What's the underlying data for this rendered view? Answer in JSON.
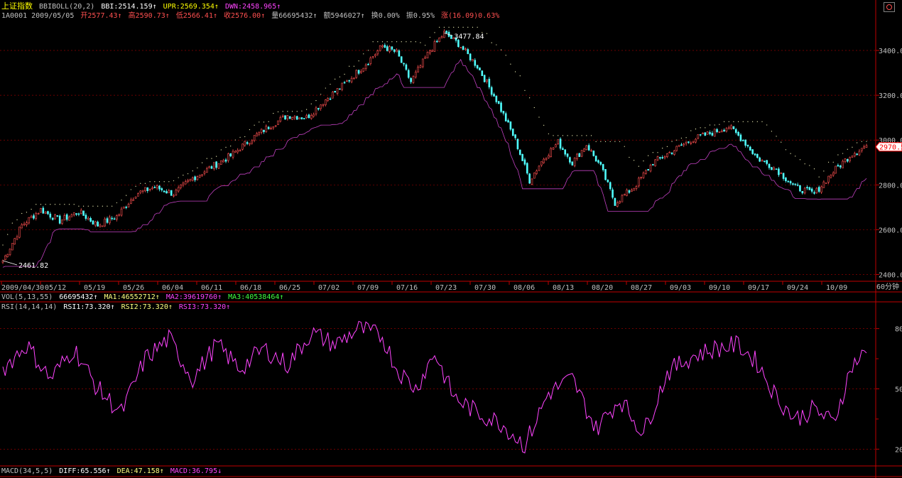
{
  "header": {
    "index_name": "上证指数",
    "indicator": "BBIBOLL(20,2)",
    "bbi": "BBI:2514.159",
    "upr": "UPR:2569.354",
    "dwn": "DWN:2458.965"
  },
  "info": {
    "code_date": "1A0001 2009/05/05",
    "open": "开2577.43",
    "high": "高2590.73",
    "low": "低2566.41",
    "close": "收2576.00",
    "vol": "量66695432",
    "amount": "额5946027",
    "turnover": "换0.00%",
    "amplitude": "振0.95%",
    "change": "涨(16.09)0.63%"
  },
  "price_panel": {
    "y_ticks": [
      2400,
      2600,
      2800,
      3000,
      3200,
      3400
    ],
    "y_tick_labels": [
      "2400.00",
      "2600.00",
      "2800.00",
      "3000.00",
      "3200.00",
      "3400.00"
    ],
    "last_price_label": "2970.5",
    "high_annotation": "3477.84",
    "low_annotation": "2461.82"
  },
  "dates": {
    "labels": [
      "2009/04/30",
      "05/12",
      "05/19",
      "05/26",
      "06/04",
      "06/11",
      "06/18",
      "06/25",
      "07/02",
      "07/09",
      "07/16",
      "07/23",
      "07/30",
      "08/06",
      "08/13",
      "08/20",
      "08/27",
      "09/03",
      "09/10",
      "09/17",
      "09/24",
      "10/09"
    ],
    "period": "60分钟"
  },
  "vol_row": {
    "name": "VOL(5,13,55)",
    "value": "66695432",
    "ma1": "MA1:46552712",
    "ma2": "MA2:39619760",
    "ma3": "MA3:40538464"
  },
  "rsi_row": {
    "name": "RSI(14,14,14)",
    "rsi1": "RSI1:73.320",
    "rsi2": "RSI2:73.320",
    "rsi3": "RSI3:73.320",
    "y_ticks": [
      "80",
      "50",
      "20"
    ]
  },
  "macd_row": {
    "name": "MACD(34,5,5)",
    "diff": "DIFF:65.556",
    "dea": "DEA:47.158",
    "macd": "MACD:36.795"
  },
  "colors": {
    "up": "#ff5050",
    "down": "#50ffff",
    "rsi": "#ff44ff",
    "upper_band": "#ffffc0",
    "lower_band": "#c040c0",
    "axis": "#c00000",
    "grid": "#900000",
    "header_yellow": "#ffff00"
  },
  "chart_data": {
    "type": "line",
    "price_anchors": [
      [
        0,
        2462
      ],
      [
        8,
        2620
      ],
      [
        16,
        2690
      ],
      [
        24,
        2640
      ],
      [
        32,
        2680
      ],
      [
        40,
        2620
      ],
      [
        48,
        2660
      ],
      [
        56,
        2760
      ],
      [
        64,
        2790
      ],
      [
        72,
        2760
      ],
      [
        80,
        2830
      ],
      [
        88,
        2880
      ],
      [
        96,
        2930
      ],
      [
        104,
        3000
      ],
      [
        112,
        3060
      ],
      [
        120,
        3110
      ],
      [
        128,
        3100
      ],
      [
        136,
        3180
      ],
      [
        144,
        3250
      ],
      [
        152,
        3330
      ],
      [
        160,
        3420
      ],
      [
        166,
        3390
      ],
      [
        172,
        3260
      ],
      [
        180,
        3400
      ],
      [
        186,
        3478
      ],
      [
        192,
        3430
      ],
      [
        200,
        3330
      ],
      [
        208,
        3180
      ],
      [
        216,
        3000
      ],
      [
        222,
        2820
      ],
      [
        228,
        2920
      ],
      [
        234,
        2990
      ],
      [
        240,
        2900
      ],
      [
        246,
        2980
      ],
      [
        252,
        2880
      ],
      [
        258,
        2720
      ],
      [
        266,
        2790
      ],
      [
        274,
        2900
      ],
      [
        282,
        2950
      ],
      [
        290,
        3000
      ],
      [
        298,
        3030
      ],
      [
        306,
        3060
      ],
      [
        312,
        3000
      ],
      [
        318,
        2920
      ],
      [
        326,
        2870
      ],
      [
        334,
        2790
      ],
      [
        342,
        2760
      ],
      [
        350,
        2860
      ],
      [
        358,
        2940
      ],
      [
        364,
        2975
      ]
    ],
    "rsi_anchors": [
      [
        0,
        60
      ],
      [
        10,
        72
      ],
      [
        20,
        55
      ],
      [
        30,
        70
      ],
      [
        40,
        50
      ],
      [
        50,
        38
      ],
      [
        60,
        65
      ],
      [
        70,
        75
      ],
      [
        80,
        55
      ],
      [
        90,
        72
      ],
      [
        100,
        60
      ],
      [
        110,
        70
      ],
      [
        120,
        62
      ],
      [
        130,
        78
      ],
      [
        140,
        72
      ],
      [
        150,
        80
      ],
      [
        160,
        76
      ],
      [
        166,
        60
      ],
      [
        174,
        50
      ],
      [
        182,
        68
      ],
      [
        190,
        46
      ],
      [
        200,
        38
      ],
      [
        210,
        33
      ],
      [
        220,
        22
      ],
      [
        230,
        48
      ],
      [
        240,
        55
      ],
      [
        250,
        30
      ],
      [
        260,
        45
      ],
      [
        270,
        28
      ],
      [
        280,
        58
      ],
      [
        290,
        66
      ],
      [
        300,
        70
      ],
      [
        310,
        72
      ],
      [
        318,
        63
      ],
      [
        326,
        46
      ],
      [
        334,
        35
      ],
      [
        342,
        40
      ],
      [
        350,
        33
      ],
      [
        358,
        62
      ],
      [
        364,
        68
      ]
    ]
  }
}
